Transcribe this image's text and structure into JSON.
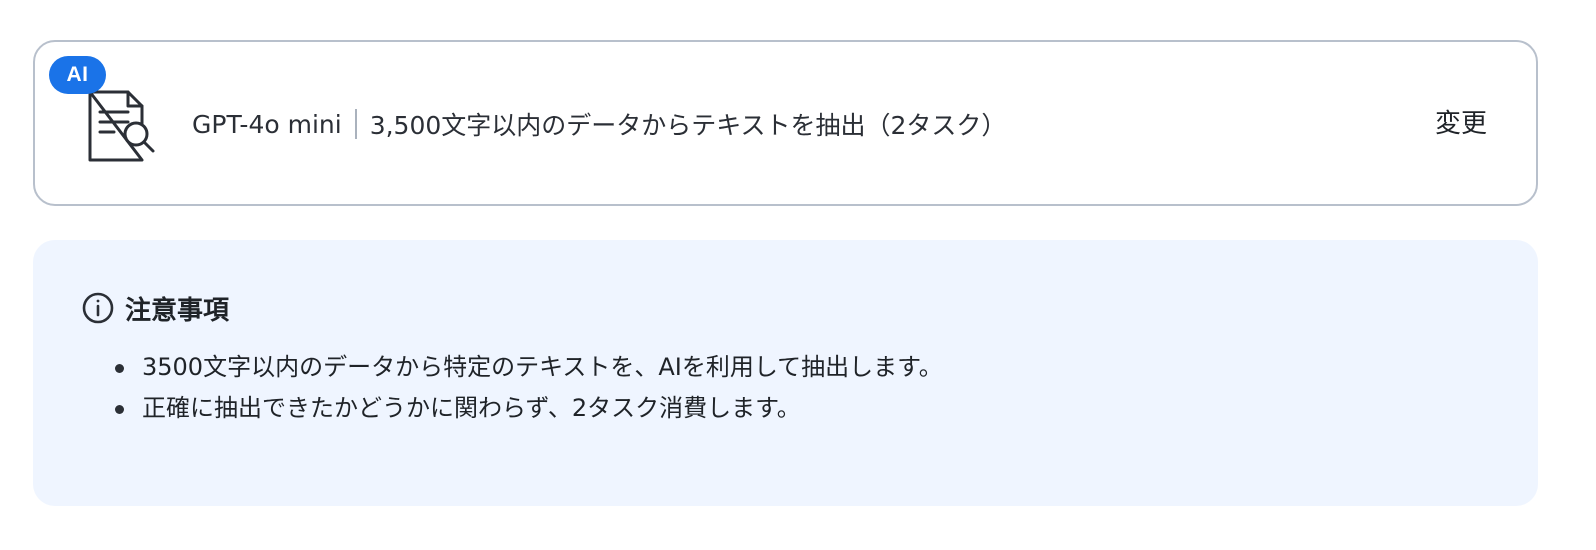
{
  "card": {
    "badge": "AI",
    "model": "GPT-4o mini",
    "description": "3,500文字以内のデータからテキストを抽出（2タスク）",
    "change_label": "変更",
    "icon": "document-search-icon",
    "badge_color": "#1a73e8",
    "border_color": "#b8c0cc"
  },
  "notice": {
    "icon": "info-icon",
    "title": "注意事項",
    "background": "#eff5ff",
    "items": [
      "3500文字以内のデータから特定のテキストを、AIを利用して抽出します。",
      "正確に抽出できたかどうかに関わらず、2タスク消費します。"
    ]
  }
}
